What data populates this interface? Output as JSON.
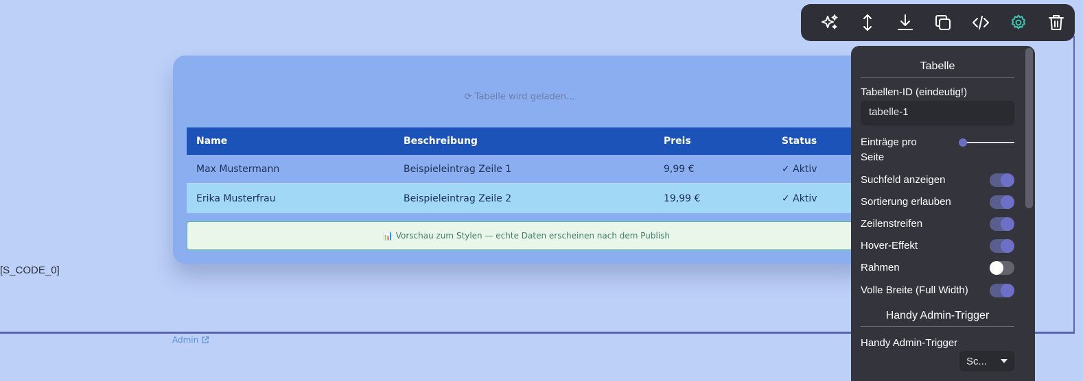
{
  "page": {
    "code_placeholder": "[S_CODE_0]",
    "admin_link": "Admin"
  },
  "table_card": {
    "loading_text": "⟳ Tabelle wird geladen...",
    "columns": [
      "Name",
      "Beschreibung",
      "Preis",
      "Status"
    ],
    "rows": [
      [
        "Max Mustermann",
        "Beispieleintrag Zeile 1",
        "9,99 €",
        "✓ Aktiv"
      ],
      [
        "Erika Musterfrau",
        "Beispieleintrag Zeile 2",
        "19,99 €",
        "✓ Aktiv"
      ]
    ],
    "preview_notice": "📊 Vorschau zum Stylen — echte Daten erscheinen nach dem Publish"
  },
  "toolbar": {
    "buttons": [
      "sparkle-icon",
      "resize-vertical-icon",
      "download-icon",
      "copy-icon",
      "code-icon",
      "gear-icon",
      "trash-icon"
    ],
    "active_color": "#3fc3b3",
    "icon_color": "#ffffff"
  },
  "settings_panel": {
    "section_title": "Tabelle",
    "table_id_label": "Tabellen-ID (eindeutig!)",
    "table_id_value": "tabelle-1",
    "entries_per_page_label": "Einträge pro Seite",
    "entries_per_page_level": 0,
    "toggles": [
      {
        "label": "Suchfeld anzeigen",
        "on": true
      },
      {
        "label": "Sortierung erlauben",
        "on": true
      },
      {
        "label": "Zeilenstreifen",
        "on": true
      },
      {
        "label": "Hover-Effekt",
        "on": true
      },
      {
        "label": "Rahmen",
        "on": false
      },
      {
        "label": "Volle Breite (Full Width)",
        "on": true
      }
    ],
    "section2_title": "Handy Admin-Trigger",
    "trigger_label": "Handy Admin-Trigger",
    "trigger_select_value": "Sc..."
  }
}
